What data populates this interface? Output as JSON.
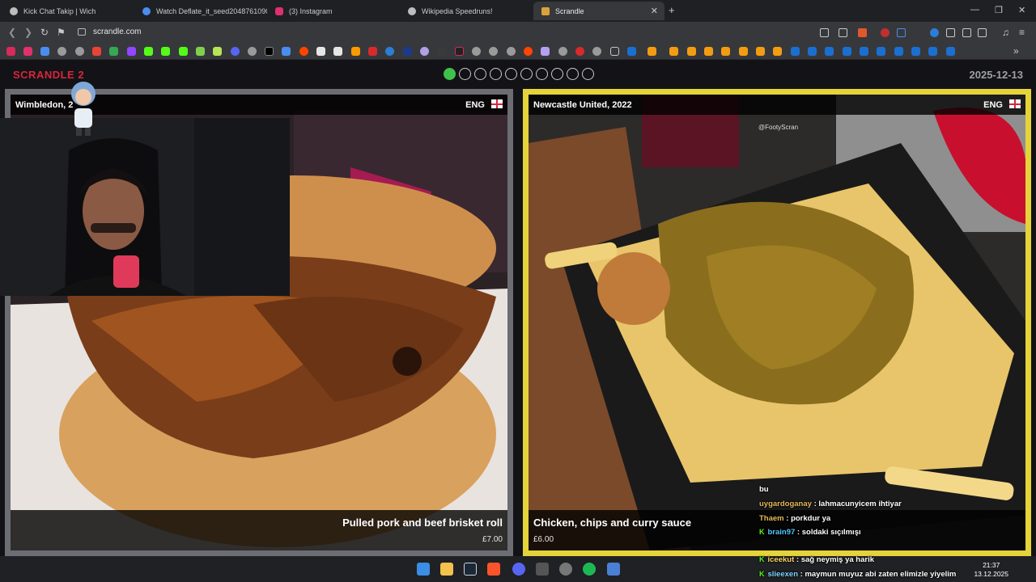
{
  "browser": {
    "tabs": [
      {
        "title": "Kick Chat Takip | Wich",
        "active": false
      },
      {
        "title": "Watch Deflate_it_seed2048761090 | S",
        "active": false
      },
      {
        "title": "(3) Instagram",
        "active": false
      },
      {
        "title": "Wikipedia Speedruns!",
        "active": false
      },
      {
        "title": "Scrandle",
        "active": true
      }
    ],
    "new_tab": "+",
    "url": "scrandle.com",
    "window_controls": [
      "minimize",
      "maximize",
      "close"
    ]
  },
  "game": {
    "brand": "SCRANDLE 2",
    "date": "2025-12-13",
    "rounds_total": 10,
    "rounds_done": 1,
    "left": {
      "club": "Wimbledon, 2",
      "country": "ENG",
      "dish": "Pulled pork and beef brisket roll",
      "price": "£7.00"
    },
    "right": {
      "club": "Newcastle United, 2022",
      "country": "ENG",
      "dish": "Chicken, chips and curry sauce",
      "price": "£6.00",
      "watermark": "@FootyScran"
    }
  },
  "chat": [
    {
      "user": "",
      "text": "bu"
    },
    {
      "user": "uygardoganay",
      "text": "lahmacunyicem ihtiyar"
    },
    {
      "user": "Thaem",
      "text": "porkdur ya"
    },
    {
      "user": "brain97",
      "text": "soldaki sıçılmışı"
    },
    {
      "user": "iceekut",
      "text": "sağ neymiş ya harik"
    },
    {
      "user": "slieexen",
      "text": "maymun muyuz abi zaten elimizle yiyelim"
    }
  ],
  "taskbar": {
    "time": "21:37",
    "date": "13.12.2025"
  },
  "colors": {
    "brand_red": "#d7263d",
    "selected_border": "#e5d33a",
    "unselected_border": "#6b6d72",
    "progress_done": "#3fc24a",
    "kick_green": "#53fc18"
  }
}
